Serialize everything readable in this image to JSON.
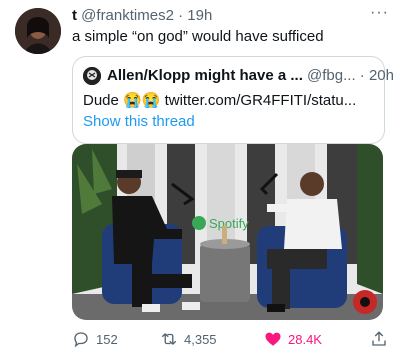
{
  "tweet": {
    "display_name": "t",
    "handle": "@franktimes2",
    "separator": "·",
    "time": "19h",
    "more": "···",
    "text": "a simple “on god” would have sufficed"
  },
  "quoted_tweet": {
    "display_name": "Allen/Klopp might have a ...",
    "handle": "@fbg...",
    "separator": "·",
    "time": "20h",
    "text_prefix": "Dude",
    "emoji": "😭😭",
    "link": "twitter.com/GR4FFITI/statu...",
    "show_thread": "Show this thread"
  },
  "media": {
    "backdrop_text": "Spotify"
  },
  "actions": {
    "reply_count": "152",
    "retweet_count": "4,355",
    "like_count": "28.4K"
  },
  "colors": {
    "accent": "#1d9bf0",
    "like": "#f91880",
    "muted": "#536471",
    "border": "#cfd9de"
  }
}
